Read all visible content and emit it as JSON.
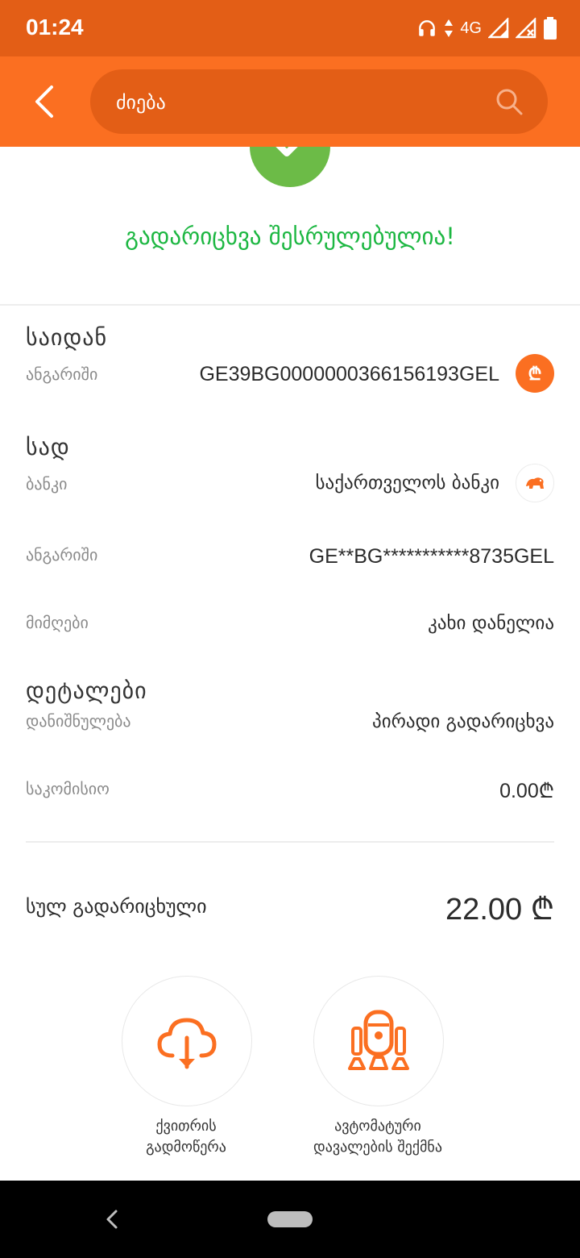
{
  "status_bar": {
    "time": "01:24",
    "network": "4G"
  },
  "header": {
    "search_placeholder": "ძიება"
  },
  "success_message": "გადარიცხვა შესრულებულია!",
  "from": {
    "section_title": "საიდან",
    "account_label": "ანგარიში",
    "account_value": "GE39BG0000000366156193GEL",
    "currency_badge": "₾"
  },
  "to": {
    "section_title": "სად",
    "bank_label": "ბანკი",
    "bank_value": "საქართველოს ბანკი",
    "account_label": "ანგარიში",
    "account_value": "GE**BG***********8735GEL",
    "recipient_label": "მიმღები",
    "recipient_value": "კახი დანელია"
  },
  "details": {
    "section_title": "დეტალები",
    "purpose_label": "დანიშნულება",
    "purpose_value": "პირადი გადარიცხვა",
    "commission_label": "საკომისიო",
    "commission_value": "0.00₾"
  },
  "total": {
    "label": "სულ გადარიცხული",
    "value": "22.00 ₾"
  },
  "actions": [
    {
      "line1": "ქვითრის",
      "line2": "გადმოწერა",
      "icon": "cloud-download-icon"
    },
    {
      "line1": "ავტომატური",
      "line2": "დავალების შექმნა",
      "icon": "robot-icon"
    }
  ],
  "colors": {
    "accent": "#fb6f21",
    "accent_dark": "#e35e16",
    "success": "#1db742",
    "check": "#6cbb47"
  }
}
